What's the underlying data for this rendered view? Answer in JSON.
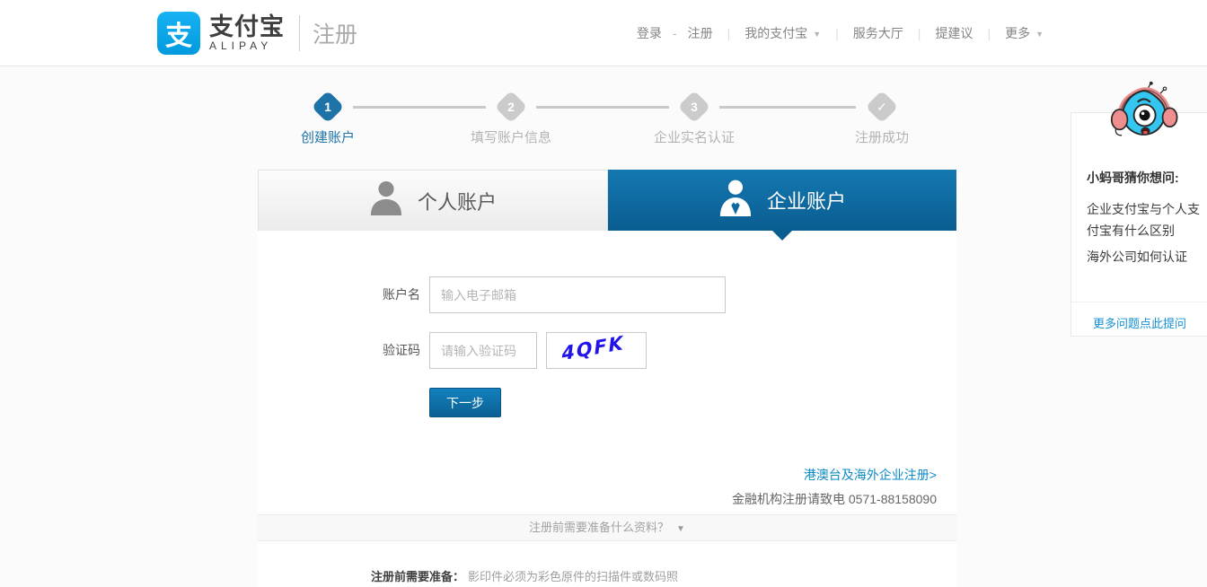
{
  "header": {
    "logo": {
      "icon_char": "支",
      "brand_cn": "支付宝",
      "brand_en": "ALIPAY",
      "page_title": "注册"
    },
    "nav": {
      "login": "登录",
      "register": "注册",
      "my_alipay": "我的支付宝",
      "service_hall": "服务大厅",
      "suggest": "提建议",
      "more": "更多"
    }
  },
  "steps": [
    {
      "num": "1",
      "label": "创建账户"
    },
    {
      "num": "2",
      "label": "填写账户信息"
    },
    {
      "num": "3",
      "label": "企业实名认证"
    },
    {
      "num": "✓",
      "label": "注册成功"
    }
  ],
  "tabs": {
    "personal": "个人账户",
    "enterprise": "企业账户"
  },
  "form": {
    "account_label": "账户名",
    "account_placeholder": "输入电子邮箱",
    "captcha_label": "验证码",
    "captcha_placeholder": "请输入验证码",
    "captcha_value": "4QFK",
    "submit_label": "下一步",
    "overseas_link": "港澳台及海外企业注册>",
    "finance_note": "金融机构注册请致电 0571-88158090"
  },
  "accordion": {
    "question": "注册前需要准备什么资料？"
  },
  "prepare": {
    "label": "注册前需要准备：",
    "text": "影印件必须为彩色原件的扫描件或数码照"
  },
  "sidebar": {
    "title": "小蚂哥猜你想问:",
    "questions": [
      "企业支付宝与个人支付宝有什么区别",
      "海外公司如何认证"
    ],
    "more_link": "更多问题点此提问"
  },
  "colors": {
    "brand_blue": "#02a0e2",
    "tab_blue": "#0e6dab",
    "step_active_blue": "#1d73a7",
    "link_blue": "#108ee9",
    "captcha_blue": "#2213e8"
  }
}
